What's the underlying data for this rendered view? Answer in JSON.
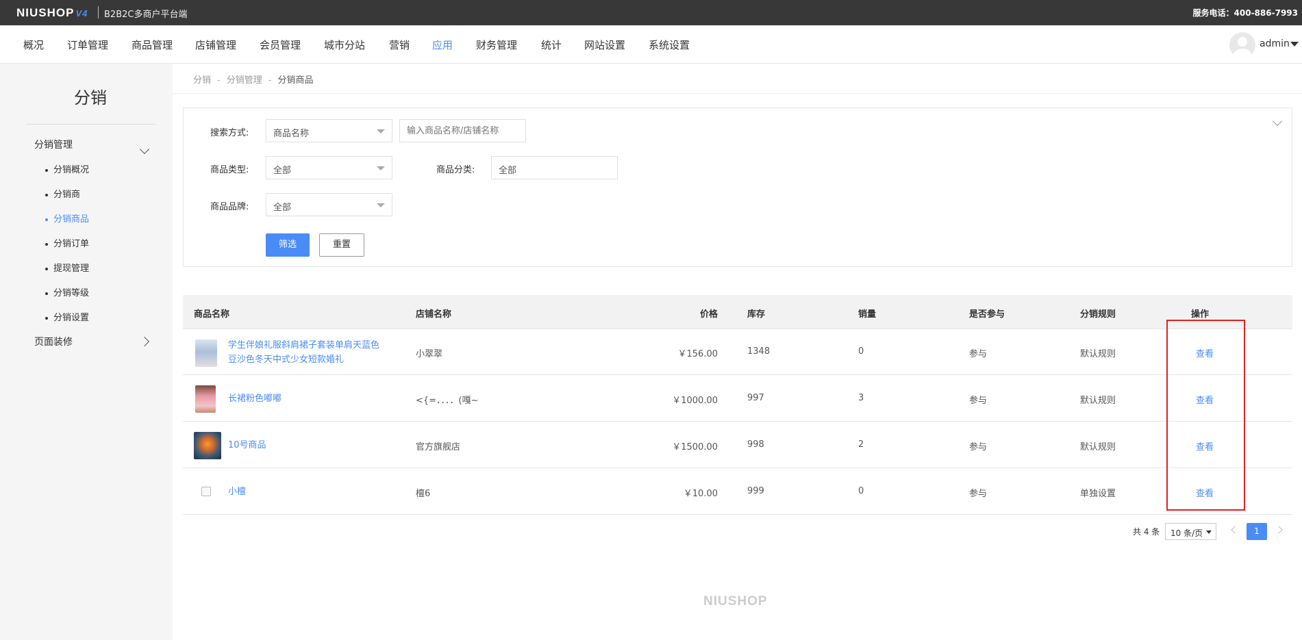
{
  "topbar": {
    "logo": "NIUSHOP",
    "logo_version": "V4",
    "subtitle": "B2B2C多商户平台端",
    "phone": "服务电话：400-886-7993"
  },
  "nav": {
    "items": [
      "概况",
      "订单管理",
      "商品管理",
      "店铺管理",
      "会员管理",
      "城市分站",
      "营销",
      "应用",
      "财务管理",
      "统计",
      "网站设置",
      "系统设置"
    ],
    "active": "应用",
    "user": "admin"
  },
  "sidebar": {
    "title": "分销",
    "group1": "分销管理",
    "items": [
      "分销概况",
      "分销商",
      "分销商品",
      "分销订单",
      "提现管理",
      "分销等级",
      "分销设置"
    ],
    "active": "分销商品",
    "group2": "页面装修"
  },
  "breadcrumb": {
    "a": "分销",
    "b": "分销管理",
    "c": "分销商品",
    "sep": "-"
  },
  "filter": {
    "search_mode_label": "搜索方式:",
    "search_mode_value": "商品名称",
    "search_placeholder": "输入商品名称/店铺名称",
    "type_label": "商品类型:",
    "type_value": "全部",
    "category_label": "商品分类:",
    "category_value": "全部",
    "brand_label": "商品品牌:",
    "brand_value": "全部",
    "filter_btn": "筛选",
    "reset_btn": "重置"
  },
  "table": {
    "headers": {
      "name": "商品名称",
      "shop": "店铺名称",
      "price": "价格",
      "stock": "库存",
      "sales": "销量",
      "join": "是否参与",
      "rule": "分销规则",
      "op": "操作"
    },
    "rows": [
      {
        "name1": "学生伴娘礼服斜肩裙子套装单肩天蓝色",
        "name2": "豆沙色冬天中式少女短款婚礼",
        "shop": "小翠翠",
        "price": "￥156.00",
        "stock": "1348",
        "sales": "0",
        "join": "参与",
        "rule": "默认规则",
        "op": "查看"
      },
      {
        "name1": "长裙粉色嘟嘟",
        "shop": "<{=．．．．(嘎~",
        "price": "￥1000.00",
        "stock": "997",
        "sales": "3",
        "join": "参与",
        "rule": "默认规则",
        "op": "查看"
      },
      {
        "name1": "10号商品",
        "shop": "官方旗舰店",
        "price": "￥1500.00",
        "stock": "998",
        "sales": "2",
        "join": "参与",
        "rule": "默认规则",
        "op": "查看"
      },
      {
        "name1": "小檀",
        "shop": "檀6",
        "price": "￥10.00",
        "stock": "999",
        "sales": "0",
        "join": "参与",
        "rule": "单独设置",
        "op": "查看"
      }
    ]
  },
  "pagination": {
    "total": "共 4 条",
    "page_size": "10 条/页",
    "current": "1"
  },
  "footer": {
    "logo": "NIUSHOP"
  }
}
